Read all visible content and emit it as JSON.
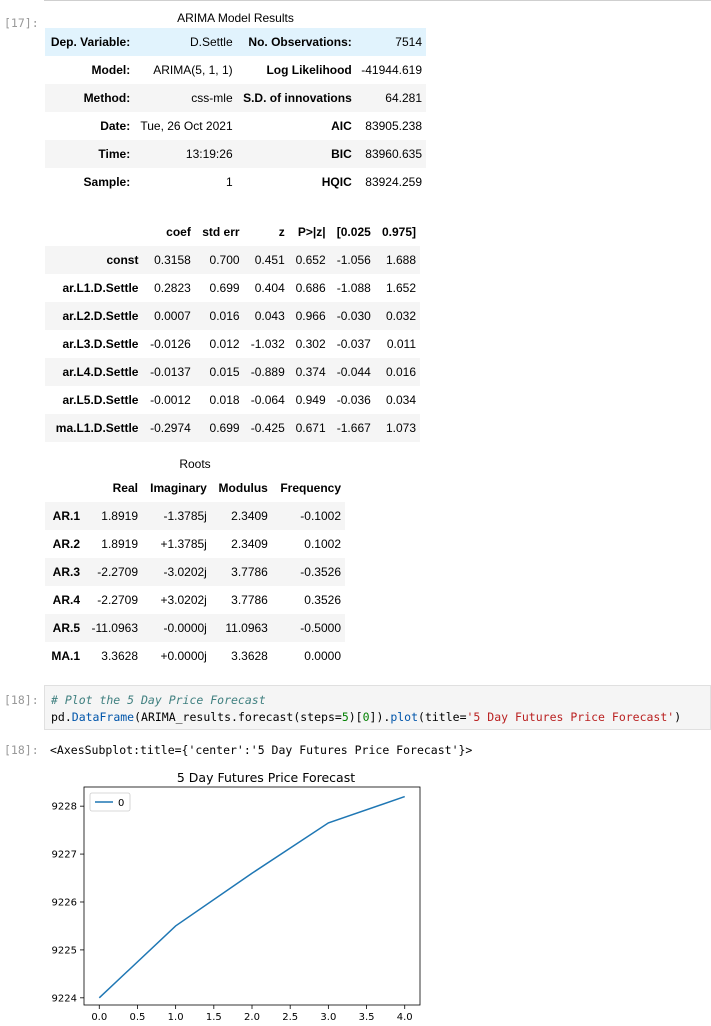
{
  "cells": {
    "c17_prompt": "[17]:",
    "c18_in_prompt": "[18]:",
    "c18_out_prompt": "[18]:",
    "c18_comment": "# Plot the 5 Day Price Forecast",
    "c18_code_prefix": "pd.",
    "c18_code_fn": "DataFrame",
    "c18_code_mid1": "(ARIMA_results.forecast(steps=",
    "c18_code_num1": "5",
    "c18_code_mid2": ")[",
    "c18_code_num2": "0",
    "c18_code_mid3": "]).",
    "c18_code_fn2": "plot",
    "c18_code_mid4": "(title=",
    "c18_code_str": "'5 Day Futures Price Forecast'",
    "c18_code_end": ")",
    "c18_output": "<AxesSubplot:title={'center':'5 Day Futures Price Forecast'}>"
  },
  "summary": {
    "title": "ARIMA Model Results",
    "rows": [
      [
        "Dep. Variable:",
        "D.Settle",
        "No. Observations:",
        "7514"
      ],
      [
        "Model:",
        "ARIMA(5, 1, 1)",
        "Log Likelihood",
        "-41944.619"
      ],
      [
        "Method:",
        "css-mle",
        "S.D. of innovations",
        "64.281"
      ],
      [
        "Date:",
        "Tue, 26 Oct 2021",
        "AIC",
        "83905.238"
      ],
      [
        "Time:",
        "13:19:26",
        "BIC",
        "83960.635"
      ],
      [
        "Sample:",
        "1",
        "HQIC",
        "83924.259"
      ]
    ]
  },
  "coef": {
    "headers": [
      "",
      "coef",
      "std err",
      "z",
      "P>|z|",
      "[0.025",
      "0.975]"
    ],
    "rows": [
      [
        "const",
        "0.3158",
        "0.700",
        "0.451",
        "0.652",
        "-1.056",
        "1.688"
      ],
      [
        "ar.L1.D.Settle",
        "0.2823",
        "0.699",
        "0.404",
        "0.686",
        "-1.088",
        "1.652"
      ],
      [
        "ar.L2.D.Settle",
        "0.0007",
        "0.016",
        "0.043",
        "0.966",
        "-0.030",
        "0.032"
      ],
      [
        "ar.L3.D.Settle",
        "-0.0126",
        "0.012",
        "-1.032",
        "0.302",
        "-0.037",
        "0.011"
      ],
      [
        "ar.L4.D.Settle",
        "-0.0137",
        "0.015",
        "-0.889",
        "0.374",
        "-0.044",
        "0.016"
      ],
      [
        "ar.L5.D.Settle",
        "-0.0012",
        "0.018",
        "-0.064",
        "0.949",
        "-0.036",
        "0.034"
      ],
      [
        "ma.L1.D.Settle",
        "-0.2974",
        "0.699",
        "-0.425",
        "0.671",
        "-1.667",
        "1.073"
      ]
    ]
  },
  "roots": {
    "title": "Roots",
    "headers": [
      "",
      "Real",
      "Imaginary",
      "Modulus",
      "Frequency"
    ],
    "rows": [
      [
        "AR.1",
        "1.8919",
        "-1.3785j",
        "2.3409",
        "-0.1002"
      ],
      [
        "AR.2",
        "1.8919",
        "+1.3785j",
        "2.3409",
        "0.1002"
      ],
      [
        "AR.3",
        "-2.2709",
        "-3.0202j",
        "3.7786",
        "-0.3526"
      ],
      [
        "AR.4",
        "-2.2709",
        "+3.0202j",
        "3.7786",
        "0.3526"
      ],
      [
        "AR.5",
        "-11.0963",
        "-0.0000j",
        "11.0963",
        "-0.5000"
      ],
      [
        "MA.1",
        "3.3628",
        "+0.0000j",
        "3.3628",
        "0.0000"
      ]
    ]
  },
  "chart_data": {
    "type": "line",
    "title": "5 Day Futures Price Forecast",
    "x": [
      0,
      1,
      2,
      3,
      4
    ],
    "series": [
      {
        "name": "0",
        "values": [
          9224.0,
          9225.5,
          9226.6,
          9227.65,
          9228.2
        ],
        "color": "#1f77b4"
      }
    ],
    "xlim": [
      -0.2,
      4.2
    ],
    "ylim": [
      9223.85,
      9228.4
    ],
    "xticks": [
      "0.0",
      "0.5",
      "1.0",
      "1.5",
      "2.0",
      "2.5",
      "3.0",
      "3.5",
      "4.0"
    ],
    "yticks": [
      "9224",
      "9225",
      "9226",
      "9227",
      "9228"
    ],
    "legend": "upper left",
    "grid": false
  }
}
